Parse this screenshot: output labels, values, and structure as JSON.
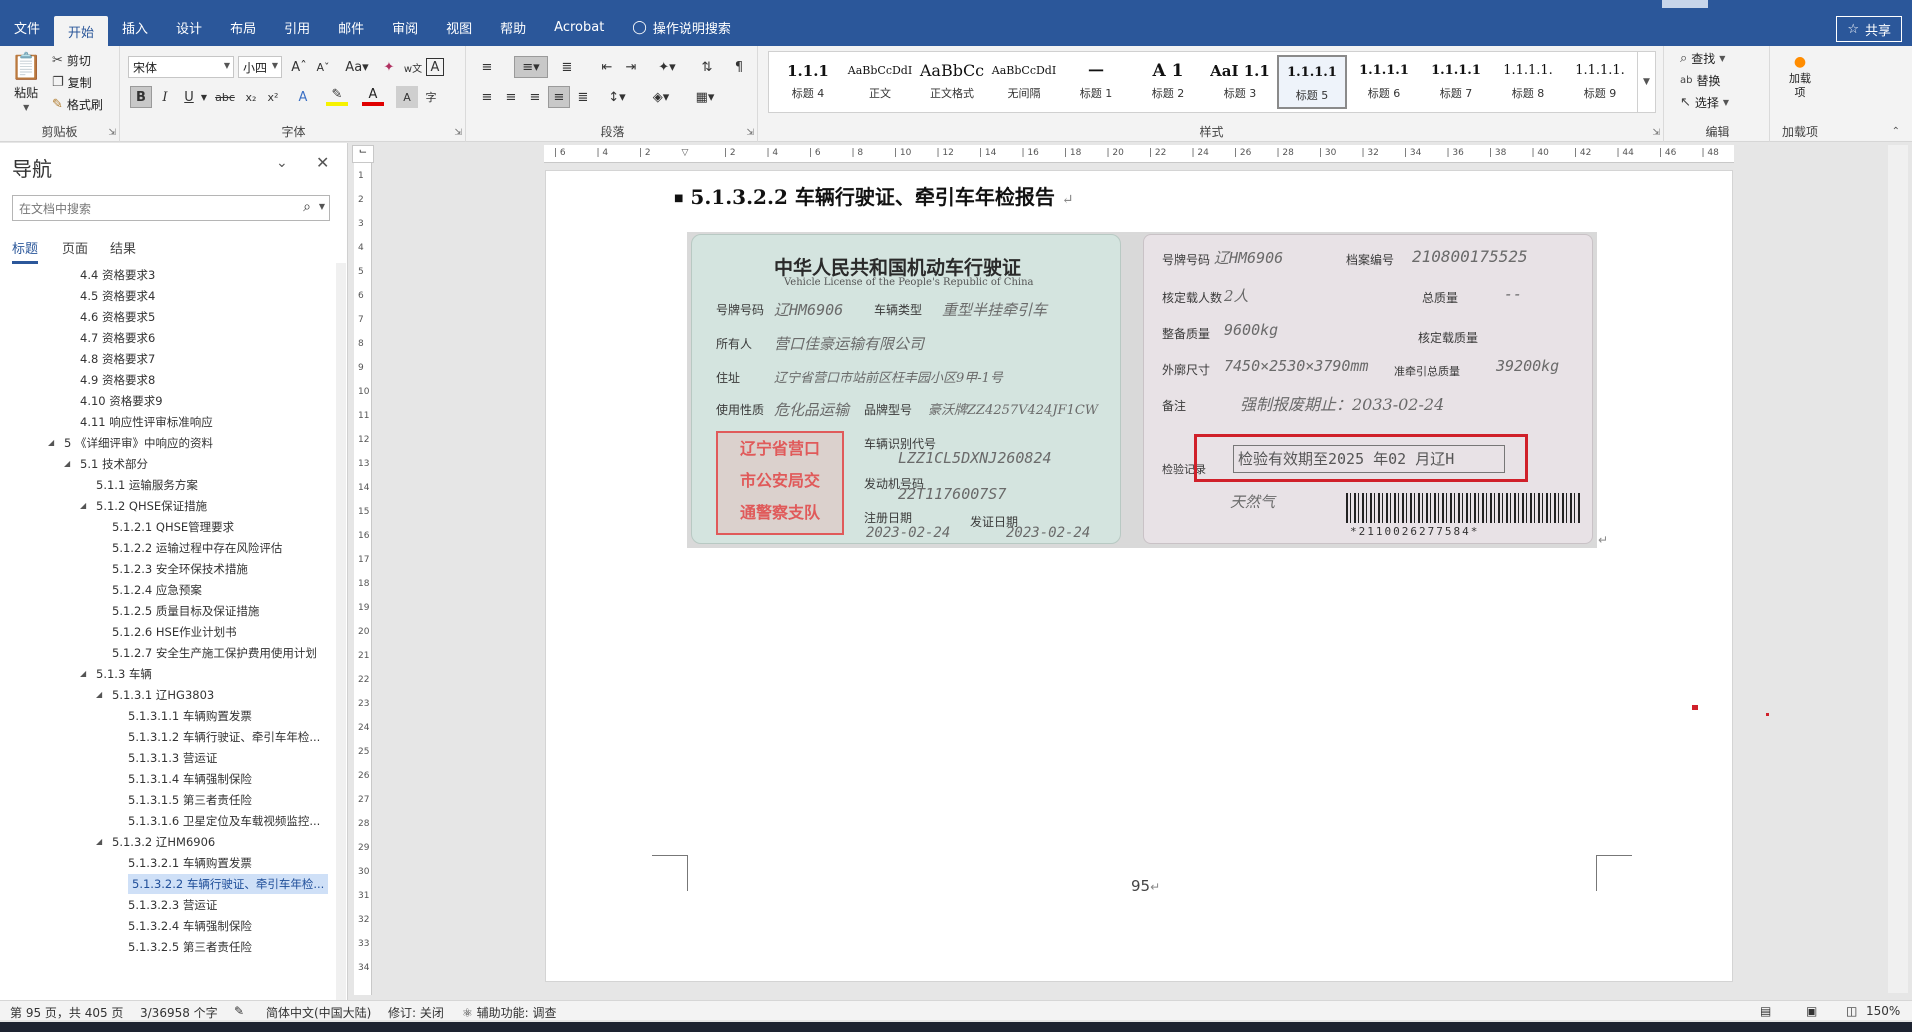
{
  "menu": {
    "tabs": [
      "文件",
      "开始",
      "插入",
      "设计",
      "布局",
      "引用",
      "邮件",
      "审阅",
      "视图",
      "帮助",
      "Acrobat"
    ],
    "active_tab": "开始",
    "tell_me": "操作说明搜索",
    "share": "共享"
  },
  "ribbon": {
    "clipboard": {
      "paste": "粘贴",
      "cut": "剪切",
      "copy": "复制",
      "format_painter": "格式刷",
      "label": "剪贴板"
    },
    "font": {
      "name": "宋体",
      "size": "小四",
      "label": "字体"
    },
    "paragraph": {
      "label": "段落"
    },
    "styles": {
      "label": "样式",
      "items": [
        {
          "preview": "1.1.1",
          "name": "标题 4"
        },
        {
          "preview": "AaBbCcDdI",
          "name": "正文"
        },
        {
          "preview": "AaBbCc",
          "name": "正文格式"
        },
        {
          "preview": "AaBbCcDdI",
          "name": "无间隔"
        },
        {
          "preview": "一",
          "name": "标题 1"
        },
        {
          "preview": "A 1",
          "name": "标题 2"
        },
        {
          "preview": "AaI 1.1",
          "name": "标题 3"
        },
        {
          "preview": "1.1.1.1",
          "name": "标题 5"
        },
        {
          "preview": "1.1.1.1",
          "name": "标题 6"
        },
        {
          "preview": "1.1.1.1",
          "name": "标题 7"
        },
        {
          "preview": "1.1.1.1.",
          "name": "标题 8"
        },
        {
          "preview": "1.1.1.1.",
          "name": "标题 9"
        }
      ],
      "selected": "标题 5"
    },
    "editing": {
      "find": "查找",
      "replace": "替换",
      "select": "选择",
      "label": "编辑"
    },
    "addins": {
      "button": "加载项",
      "label": "加载项"
    }
  },
  "nav": {
    "title": "导航",
    "search_placeholder": "在文档中搜索",
    "tabs": [
      "标题",
      "页面",
      "结果"
    ],
    "active_tab": "标题",
    "items": [
      {
        "text": "4.4 资格要求3",
        "level": 1
      },
      {
        "text": "4.5 资格要求4",
        "level": 1
      },
      {
        "text": "4.6 资格要求5",
        "level": 1
      },
      {
        "text": "4.7 资格要求6",
        "level": 1
      },
      {
        "text": "4.8 资格要求7",
        "level": 1
      },
      {
        "text": "4.9 资格要求8",
        "level": 1
      },
      {
        "text": "4.10 资格要求9",
        "level": 1
      },
      {
        "text": "4.11 响应性评审标准响应",
        "level": 1
      },
      {
        "text": "5 《详细评审》中响应的资料",
        "level": 0,
        "expanded": true
      },
      {
        "text": "5.1 技术部分",
        "level": 1,
        "expanded": true
      },
      {
        "text": "5.1.1 运输服务方案",
        "level": 2
      },
      {
        "text": "5.1.2 QHSE保证措施",
        "level": 2,
        "expanded": true
      },
      {
        "text": "5.1.2.1 QHSE管理要求",
        "level": 3
      },
      {
        "text": "5.1.2.2 运输过程中存在风险评估",
        "level": 3
      },
      {
        "text": "5.1.2.3 安全环保技术措施",
        "level": 3
      },
      {
        "text": "5.1.2.4 应急预案",
        "level": 3
      },
      {
        "text": "5.1.2.5 质量目标及保证措施",
        "level": 3
      },
      {
        "text": "5.1.2.6 HSE作业计划书",
        "level": 3
      },
      {
        "text": "5.1.2.7 安全生产施工保护费用使用计划",
        "level": 3
      },
      {
        "text": "5.1.3 车辆",
        "level": 2,
        "expanded": true
      },
      {
        "text": "5.1.3.1 辽HG3803",
        "level": 3,
        "expanded": true
      },
      {
        "text": "5.1.3.1.1 车辆购置发票",
        "level": 4
      },
      {
        "text": "5.1.3.1.2 车辆行驶证、牵引车年检...",
        "level": 4
      },
      {
        "text": "5.1.3.1.3 营运证",
        "level": 4
      },
      {
        "text": "5.1.3.1.4 车辆强制保险",
        "level": 4
      },
      {
        "text": "5.1.3.1.5 第三者责任险",
        "level": 4
      },
      {
        "text": "5.1.3.1.6 卫星定位及车载视频监控...",
        "level": 4
      },
      {
        "text": "5.1.3.2 辽HM6906",
        "level": 3,
        "expanded": true
      },
      {
        "text": "5.1.3.2.1 车辆购置发票",
        "level": 4
      },
      {
        "text": "5.1.3.2.2 车辆行驶证、牵引车年检...",
        "level": 4,
        "selected": true
      },
      {
        "text": "5.1.3.2.3 营运证",
        "level": 4
      },
      {
        "text": "5.1.3.2.4 车辆强制保险",
        "level": 4
      },
      {
        "text": "5.1.3.2.5 第三者责任险",
        "level": 4
      }
    ]
  },
  "document": {
    "heading": "5.1.3.2.2  车辆行驶证、牵引车年检报告",
    "page_number": "95",
    "license": {
      "title_cn": "中华人民共和国机动车行驶证",
      "title_en": "Vehicle License of the People's Republic of China",
      "plate_label": "号牌号码",
      "plate": "辽HM6906",
      "type_label": "车辆类型",
      "type": "重型半挂牵引车",
      "owner_label": "所有人",
      "owner": "营口佳豪运输有限公司",
      "address_label": "住址",
      "address": "辽宁省营口市站前区枉丰园小区9甲-1号",
      "use_label": "使用性质",
      "use": "危化品运输",
      "model_label": "品牌型号",
      "model": "豪沃牌ZZ4257V424JF1CW",
      "vin_label": "车辆识别代号",
      "vin": "LZZ1CL5DXNJ260824",
      "engine_label": "发动机号码",
      "engine": "22T1176007S7",
      "reg_label": "注册日期",
      "reg_date": "2023-02-24",
      "issue_label": "发证日期",
      "issue_date": "2023-02-24",
      "stamp": [
        "辽宁省营口",
        "市公安局交",
        "通警察支队"
      ],
      "file_no_label": "档案编号",
      "file_no": "210800175525",
      "plate2": "辽HM6906",
      "passengers_label": "核定载人数",
      "passengers": "2人",
      "total_mass_label": "总质量",
      "total_mass": "--",
      "curb_label": "整备质量",
      "curb": "9600kg",
      "load_label": "核定载质量",
      "dims_label": "外廓尺寸",
      "dims": "7450×2530×3790mm",
      "traction_label": "准牵引总质量",
      "traction": "39200kg",
      "note_label": "备注",
      "note": "强制报废期止：2033-02-24",
      "inspection_label": "检验记录",
      "inspection": "检验有效期至2025 年02 月辽H",
      "fuel": "天然气",
      "barcode": "*2110026277584*"
    }
  },
  "status": {
    "page": "第 95 页，共 405 页",
    "words": "3/36958 个字",
    "language": "简体中文(中国大陆)",
    "track": "修订: 关闭",
    "accessibility": "辅助功能: 调查",
    "zoom": "150%"
  }
}
